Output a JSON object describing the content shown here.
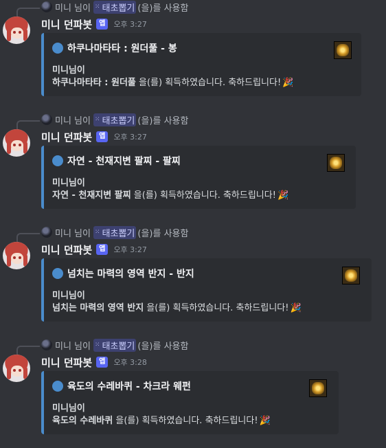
{
  "common": {
    "reply_user": "미니 님이",
    "command": "태초뽑기",
    "reply_suffix": "(을)를 사용함",
    "bot_name": "미니 던파봇",
    "app_tag": "앱",
    "embed_user": "미니님이",
    "acquired_text": " 을(를) 획득하였습니다. 축하드립니다!",
    "party_emoji": "🎉",
    "accent_color": "#4a8ccc"
  },
  "messages": [
    {
      "time": "오후 3:27",
      "title": "하쿠나마타타 : 원더풀 - 봉",
      "item": "하쿠나마타타 : 원더풀"
    },
    {
      "time": "오후 3:27",
      "title": "자연 - 천재지변 팔찌 - 팔찌",
      "item": "자연 - 천재지변 팔찌"
    },
    {
      "time": "오후 3:27",
      "title": "넘치는 마력의 영역 반지 - 반지",
      "item": "넘치는 마력의 영역 반지"
    },
    {
      "time": "오후 3:28",
      "title": "육도의 수레바퀴 - 차크라 웨펀",
      "item": "육도의 수레바퀴"
    }
  ]
}
